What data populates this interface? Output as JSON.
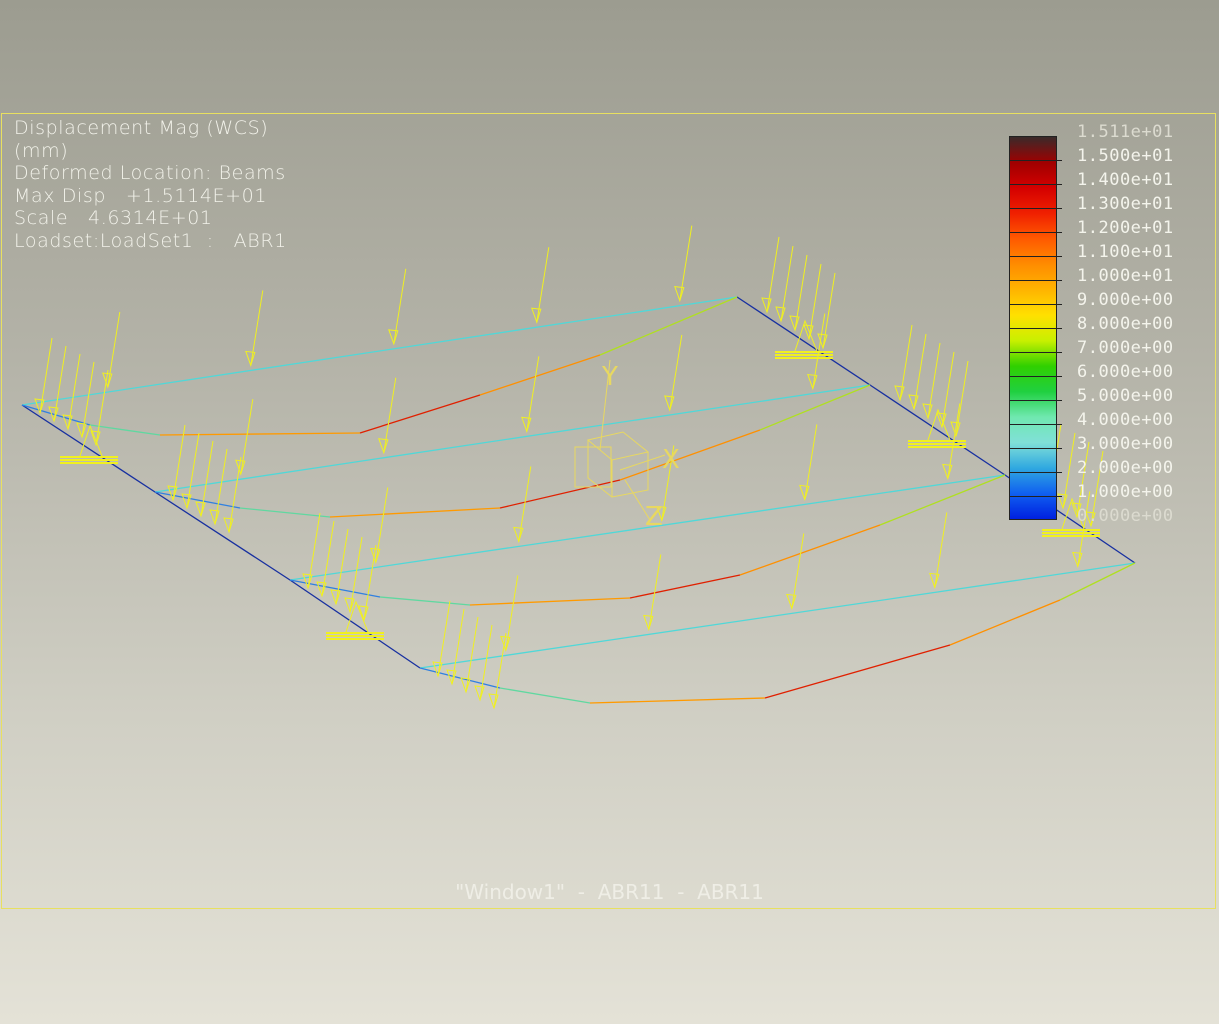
{
  "info": {
    "line1": "Displacement Mag (WCS)",
    "line2": "(mm)",
    "line3": "Deformed Location: Beams",
    "line4": "Max Disp   +1.5114E+01",
    "line5": "Scale   4.6314E+01",
    "line6": "Loadset:LoadSet1  :   ABR1"
  },
  "legend": {
    "labels": [
      "1.511e+01",
      "1.500e+01",
      "1.400e+01",
      "1.300e+01",
      "1.200e+01",
      "1.100e+01",
      "1.000e+01",
      "9.000e+00",
      "8.000e+00",
      "7.000e+00",
      "6.000e+00",
      "5.000e+00",
      "4.000e+00",
      "3.000e+00",
      "2.000e+00",
      "1.000e+00",
      "0.000e+00"
    ],
    "colors": [
      "#3a2a2a",
      "#a00000",
      "#d40000",
      "#f02000",
      "#ff5a00",
      "#ff8c00",
      "#ffb400",
      "#ffe000",
      "#c8f000",
      "#30d000",
      "#20d040",
      "#70e8b0",
      "#80e0d8",
      "#30a8e0",
      "#1060f0",
      "#0020e0",
      "#101890"
    ]
  },
  "triad": {
    "x": "X",
    "y": "Y",
    "z": "Z"
  },
  "caption": "\"Window1\"  -  ABR11  -  ABR11",
  "colors": {
    "load": "#f0f020",
    "beam": "#50d8d8",
    "edge": "#1830a0",
    "frame": "#e8e060"
  }
}
